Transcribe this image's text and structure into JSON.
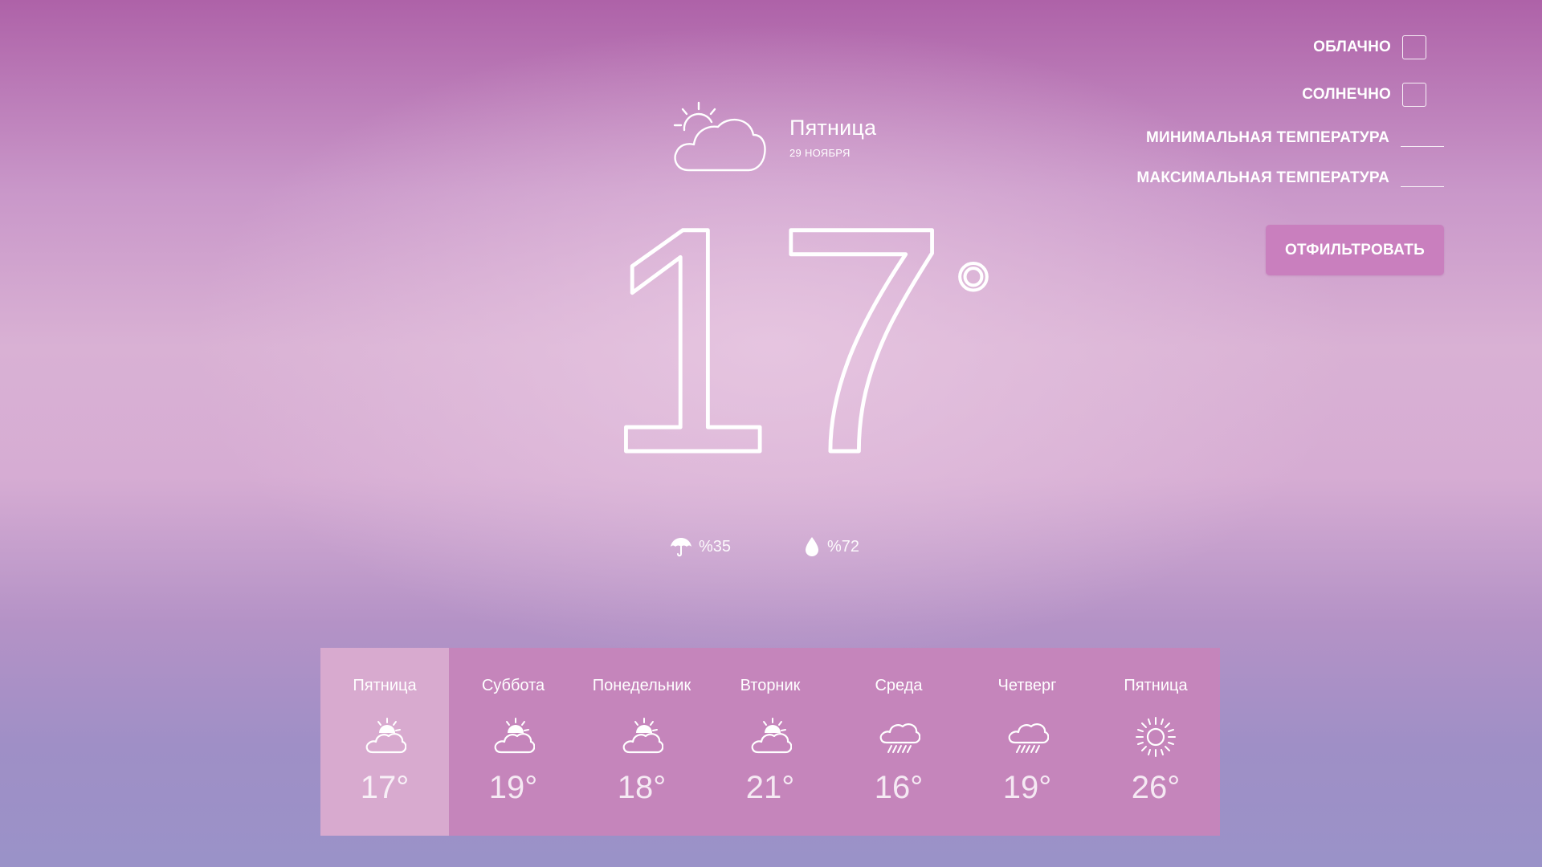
{
  "current": {
    "icon": "partly-cloudy-icon",
    "day": "Пятница",
    "date": "29 НОЯБРЯ",
    "temperature": "17",
    "degree": "°",
    "precipitation": "%35",
    "humidity": "%72"
  },
  "filter": {
    "cloudy_label": "ОБЛАЧНО",
    "sunny_label": "СОЛНЕЧНО",
    "min_temp_label": "МИНИМАЛЬНАЯ ТЕМПЕРАТУРА",
    "max_temp_label": "МАКСИМАЛЬНАЯ ТЕМПЕРАТУРА",
    "min_temp_value": "",
    "max_temp_value": "",
    "button_label": "ОТФИЛЬТРОВАТЬ"
  },
  "forecast": [
    {
      "day": "Пятница",
      "temp": "17°",
      "icon": "partly-cloudy-icon",
      "active": true
    },
    {
      "day": "Суббота",
      "temp": "19°",
      "icon": "partly-cloudy-icon",
      "active": false
    },
    {
      "day": "Понедельник",
      "temp": "18°",
      "icon": "partly-cloudy-icon",
      "active": false
    },
    {
      "day": "Вторник",
      "temp": "21°",
      "icon": "partly-cloudy-icon",
      "active": false
    },
    {
      "day": "Среда",
      "temp": "16°",
      "icon": "rain-cloud-icon",
      "active": false
    },
    {
      "day": "Четверг",
      "temp": "19°",
      "icon": "rain-cloud-icon",
      "active": false
    },
    {
      "day": "Пятница",
      "temp": "26°",
      "icon": "sun-icon",
      "active": false
    }
  ],
  "colors": {
    "forecast_bg": "#c585bb",
    "forecast_active": "#d8aacf",
    "button_bg": "#c97fbe"
  }
}
